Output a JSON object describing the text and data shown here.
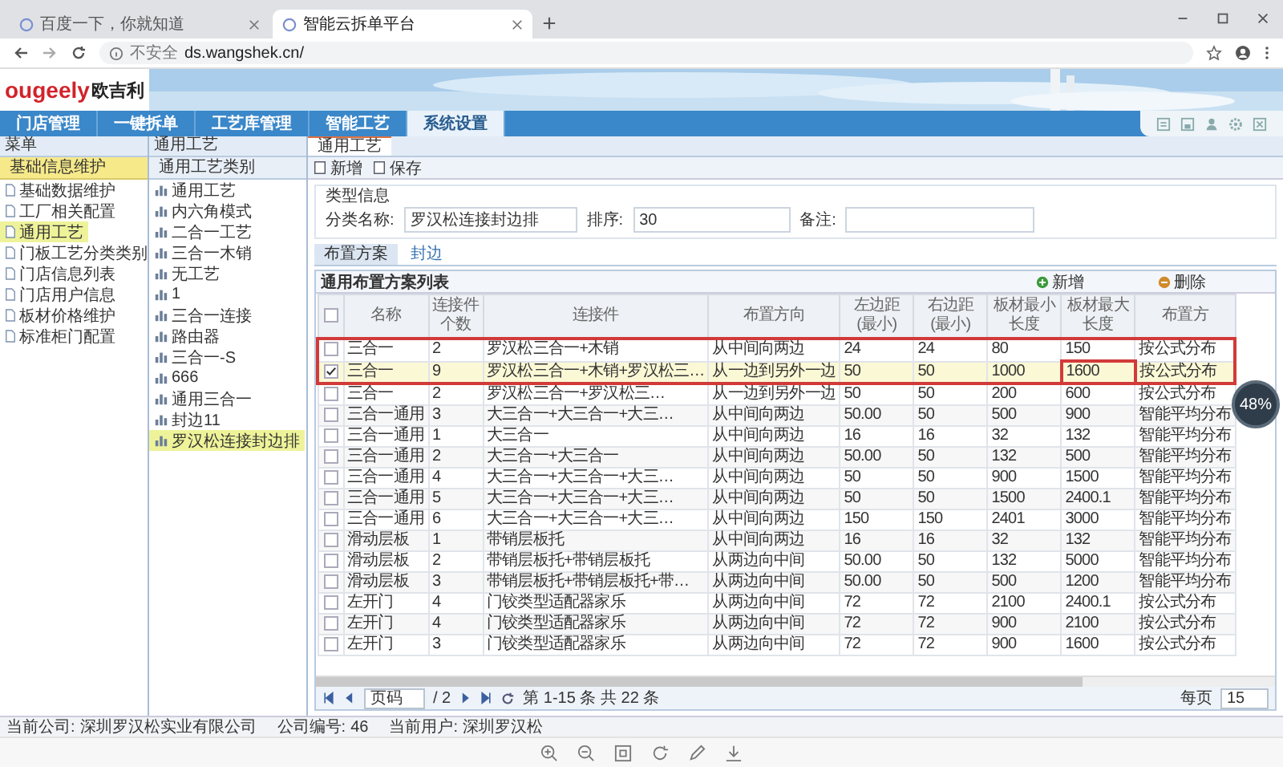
{
  "browser": {
    "tabs": [
      {
        "title": "百度一下，你就知道",
        "selected": false
      },
      {
        "title": "智能云拆单平台",
        "selected": true
      }
    ],
    "security": "不安全",
    "url": "ds.wangshek.cn/"
  },
  "logo": {
    "brand": "ougeely",
    "name": "欧吉利"
  },
  "nav": [
    {
      "label": "门店管理",
      "selected": false
    },
    {
      "label": "一键拆单",
      "selected": false
    },
    {
      "label": "工艺库管理",
      "selected": false
    },
    {
      "label": "智能工艺",
      "selected": false
    },
    {
      "label": "系统设置",
      "selected": true
    }
  ],
  "menu": {
    "title": "菜单",
    "section": "基础信息维护",
    "items": [
      {
        "label": "基础数据维护",
        "selected": false
      },
      {
        "label": "工厂相关配置",
        "selected": false
      },
      {
        "label": "通用工艺",
        "selected": true
      },
      {
        "label": "门板工艺分类类别",
        "selected": false
      },
      {
        "label": "门店信息列表",
        "selected": false
      },
      {
        "label": "门店用户信息",
        "selected": false
      },
      {
        "label": "板材价格维护",
        "selected": false
      },
      {
        "label": "标准柜门配置",
        "selected": false
      }
    ]
  },
  "categories": {
    "breadcrumb": "通用工艺",
    "title": "通用工艺类别",
    "items": [
      {
        "label": "通用工艺",
        "selected": false
      },
      {
        "label": "内六角模式",
        "selected": false
      },
      {
        "label": "二合一工艺",
        "selected": false
      },
      {
        "label": "三合一木销",
        "selected": false
      },
      {
        "label": "无工艺",
        "selected": false
      },
      {
        "label": "1",
        "selected": false
      },
      {
        "label": "三合一连接",
        "selected": false
      },
      {
        "label": "路由器",
        "selected": false
      },
      {
        "label": "三合一-S",
        "selected": false
      },
      {
        "label": "666",
        "selected": false
      },
      {
        "label": "通用三合一",
        "selected": false
      },
      {
        "label": "封边11",
        "selected": false
      },
      {
        "label": "罗汉松连接封边排",
        "selected": true
      }
    ]
  },
  "detail": {
    "tab": "通用工艺",
    "toolbar": [
      "新增",
      "保存"
    ],
    "section": "类型信息",
    "fields": [
      {
        "label": "分类名称:",
        "value": "罗汉松连接封边排"
      },
      {
        "label": "排序:",
        "value": "30"
      },
      {
        "label": "备注:"
      }
    ],
    "subtabs": [
      {
        "label": "布置方案",
        "selected": true
      },
      {
        "label": "封边",
        "selected": false
      }
    ],
    "grid": {
      "title": "通用布置方案列表",
      "actions": [
        "新增",
        "删除"
      ],
      "all_checked": false,
      "columns": [
        "名称",
        "连接件个数",
        "连接件",
        "布置方向",
        "左边距(最小)",
        "右边距(最小)",
        "板材最小长度",
        "板材最大长度",
        "布置方"
      ],
      "rows": [
        {
          "checked": false,
          "marked": true,
          "cells": [
            "三合一",
            "2",
            "罗汉松三合一+木销",
            "从中间向两边",
            "24",
            "24",
            "80",
            "150",
            "按公式分布"
          ]
        },
        {
          "checked": true,
          "marked": true,
          "cells": [
            "三合一",
            "9",
            "罗汉松三合一+木销+罗汉松三…",
            "从一边到另外一边",
            "50",
            "50",
            "1000",
            {
              "text": "1600",
              "boxed": true
            },
            "按公式分布"
          ]
        },
        {
          "checked": false,
          "marked": false,
          "cells": [
            "三合一",
            "2",
            "罗汉松三合一+罗汉松三…",
            "从一边到另外一边",
            "50",
            "50",
            "200",
            "600",
            "按公式分布"
          ]
        },
        {
          "checked": false,
          "marked": false,
          "cells": [
            "三合一通用",
            "3",
            "大三合一+大三合一+大三…",
            "从中间向两边",
            "50.00",
            "50",
            "500",
            "900",
            "智能平均分布"
          ]
        },
        {
          "checked": false,
          "marked": false,
          "cells": [
            "三合一通用",
            "1",
            "大三合一",
            "从中间向两边",
            "16",
            "16",
            "32",
            "132",
            "智能平均分布"
          ]
        },
        {
          "checked": false,
          "marked": false,
          "cells": [
            "三合一通用",
            "2",
            "大三合一+大三合一",
            "从中间向两边",
            "50.00",
            "50",
            "132",
            "500",
            "智能平均分布"
          ]
        },
        {
          "checked": false,
          "marked": false,
          "cells": [
            "三合一通用",
            "4",
            "大三合一+大三合一+大三…",
            "从中间向两边",
            "50",
            "50",
            "900",
            "1500",
            "智能平均分布"
          ]
        },
        {
          "checked": false,
          "marked": false,
          "cells": [
            "三合一通用",
            "5",
            "大三合一+大三合一+大三…",
            "从中间向两边",
            "50",
            "50",
            "1500",
            "2400.1",
            "智能平均分布"
          ]
        },
        {
          "checked": false,
          "marked": false,
          "cells": [
            "三合一通用",
            "6",
            "大三合一+大三合一+大三…",
            "从中间向两边",
            "150",
            "150",
            "2401",
            "3000",
            "智能平均分布"
          ]
        },
        {
          "checked": false,
          "marked": false,
          "cells": [
            "滑动层板",
            "1",
            "带销层板托",
            "从中间向两边",
            "16",
            "16",
            "32",
            "132",
            "智能平均分布"
          ]
        },
        {
          "checked": false,
          "marked": false,
          "cells": [
            "滑动层板",
            "2",
            "带销层板托+带销层板托",
            "从两边向中间",
            "50.00",
            "50",
            "132",
            "5000",
            "智能平均分布"
          ]
        },
        {
          "checked": false,
          "marked": false,
          "cells": [
            "滑动层板",
            "3",
            "带销层板托+带销层板托+带…",
            "从两边向中间",
            "50.00",
            "50",
            "500",
            "1200",
            "智能平均分布"
          ]
        },
        {
          "checked": false,
          "marked": false,
          "cells": [
            "左开门",
            "4",
            "门铰类型适配器家乐",
            "从两边向中间",
            "72",
            "72",
            "2100",
            "2400.1",
            "按公式分布"
          ]
        },
        {
          "checked": false,
          "marked": false,
          "cells": [
            "左开门",
            "4",
            "门铰类型适配器家乐",
            "从两边向中间",
            "72",
            "72",
            "900",
            "2100",
            "按公式分布"
          ]
        },
        {
          "checked": false,
          "marked": false,
          "cells": [
            "左开门",
            "3",
            "门铰类型适配器家乐",
            "从两边向中间",
            "72",
            "72",
            "900",
            "1600",
            "按公式分布"
          ]
        }
      ]
    },
    "pager": {
      "page": "页码",
      "total_pages": "/ 2",
      "summary": "第 1-15 条  共 22 条",
      "per_page_label": "每页",
      "per_page": "15"
    }
  },
  "status_bar": [
    {
      "label": "当前公司:",
      "value": "深圳罗汉松实业有限公司"
    },
    {
      "label": "公司编号:",
      "value": "46"
    },
    {
      "label": "当前用户:",
      "value": "深圳罗汉松"
    }
  ],
  "speed_widget": {
    "percent": "48%"
  }
}
